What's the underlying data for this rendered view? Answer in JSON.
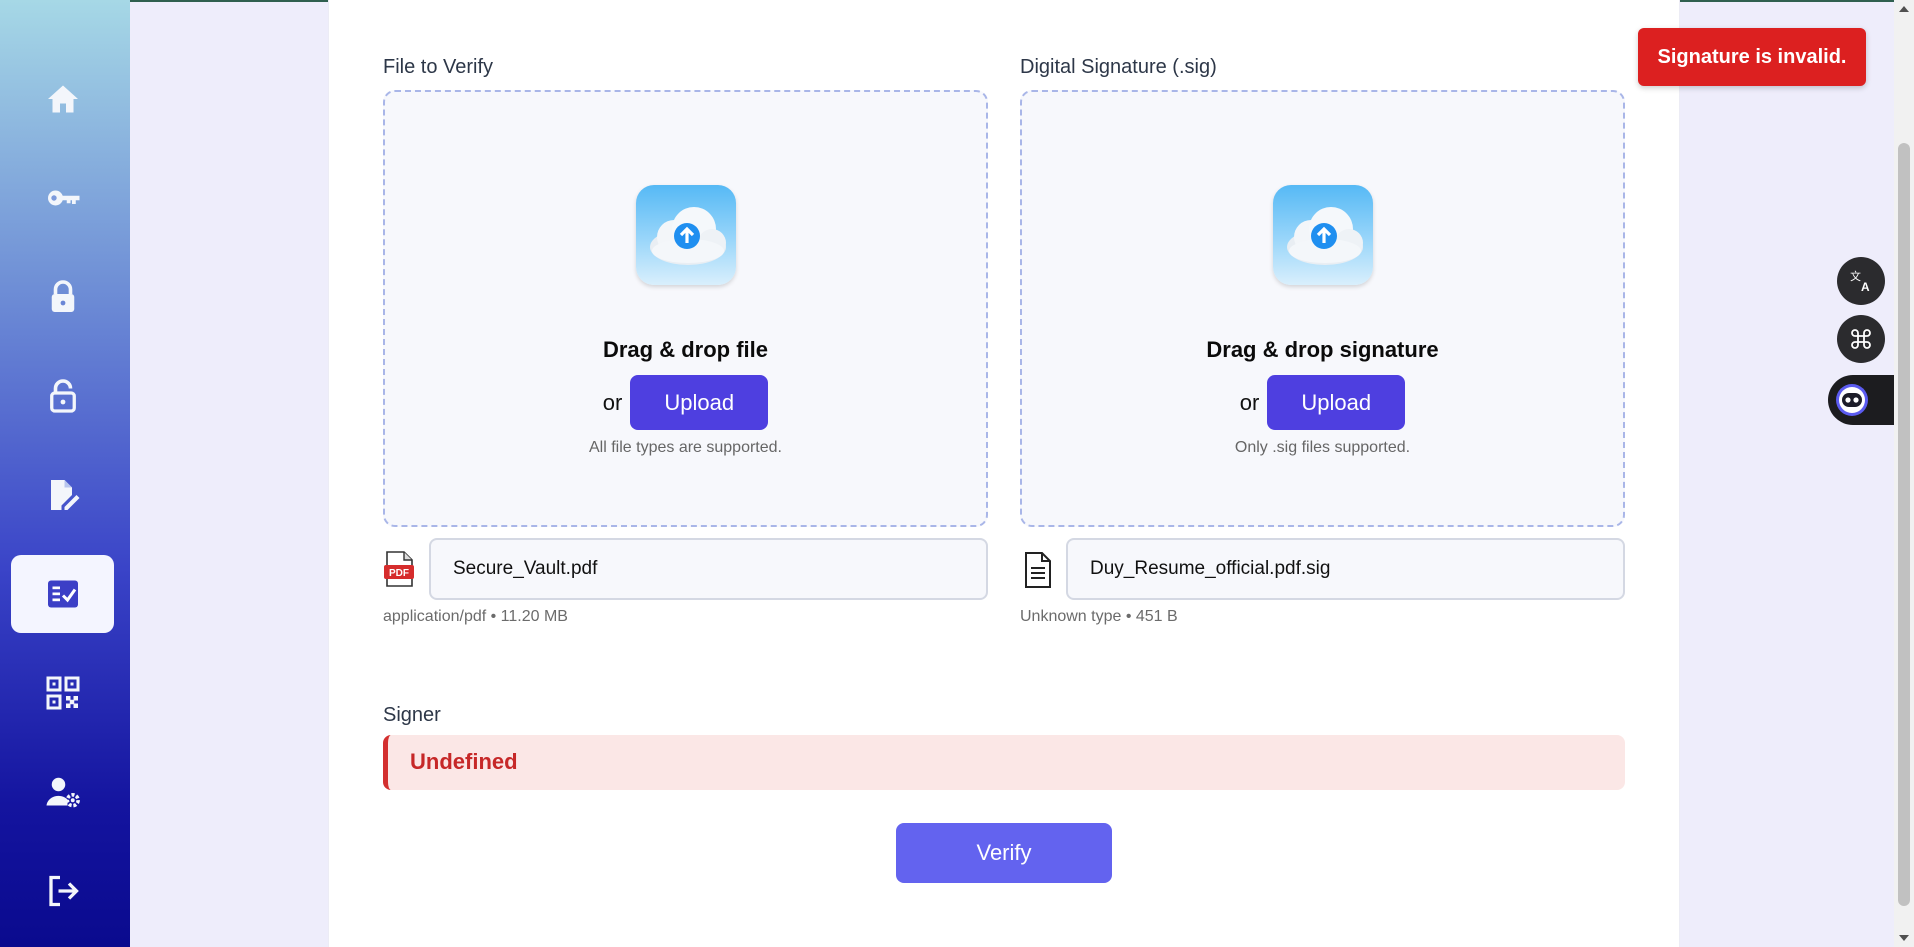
{
  "sidebar": {
    "items": [
      {
        "name": "home",
        "icon": "home-icon",
        "active": false
      },
      {
        "name": "keys",
        "icon": "key-icon",
        "active": false
      },
      {
        "name": "encrypt",
        "icon": "lock-icon",
        "active": false
      },
      {
        "name": "decrypt",
        "icon": "unlock-icon",
        "active": false
      },
      {
        "name": "sign",
        "icon": "file-signature-icon",
        "active": false
      },
      {
        "name": "verify",
        "icon": "checklist-icon",
        "active": true
      },
      {
        "name": "qr",
        "icon": "qr-code-icon",
        "active": false
      },
      {
        "name": "user-settings",
        "icon": "user-gear-icon",
        "active": false
      },
      {
        "name": "logout",
        "icon": "logout-icon",
        "active": false
      }
    ]
  },
  "file_panel": {
    "label": "File to Verify",
    "drop_title": "Drag & drop file",
    "or_text": "or",
    "upload_label": "Upload",
    "hint": "All file types are supported.",
    "file_name": "Secure_Vault.pdf",
    "file_meta": "application/pdf • 11.20 MB",
    "file_icon": "pdf-icon"
  },
  "sig_panel": {
    "label": "Digital Signature (.sig)",
    "drop_title": "Drag & drop signature",
    "or_text": "or",
    "upload_label": "Upload",
    "hint": "Only .sig files supported.",
    "file_name": "Duy_Resume_official.pdf.sig",
    "file_meta": "Unknown type • 451 B",
    "file_icon": "document-icon"
  },
  "signer": {
    "label": "Signer",
    "value": "Undefined"
  },
  "verify_label": "Verify",
  "toast": {
    "message": "Signature is invalid.",
    "color": "#dc2020"
  },
  "floating": {
    "translate_icon": "translate-icon",
    "apps_icon": "command-icon",
    "assistant_icon": "assistant-icon"
  },
  "colors": {
    "accent": "#4e3fe0",
    "verify": "#6363ef",
    "error": "#c62828"
  }
}
